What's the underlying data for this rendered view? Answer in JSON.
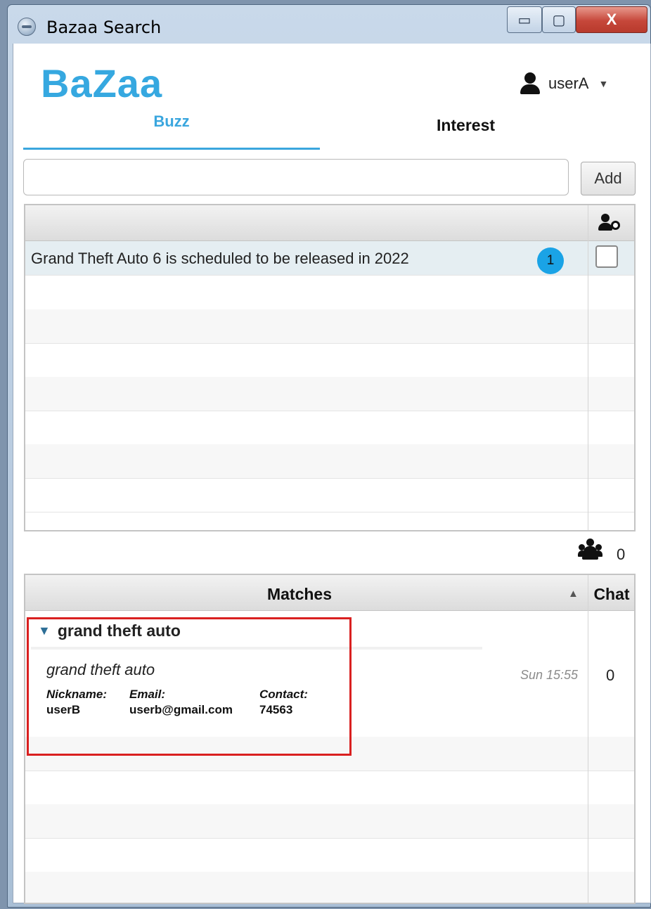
{
  "window": {
    "title": "Bazaa Search",
    "min_glyph": "▭",
    "max_glyph": "▢",
    "close_glyph": "X"
  },
  "app": {
    "logo": "BaZaa"
  },
  "user": {
    "name": "userA",
    "caret": "▼"
  },
  "tabs": {
    "buzz": "Buzz",
    "interest": "Interest",
    "active": "Buzz"
  },
  "buzz_form": {
    "input_value": "",
    "add_label": "Add"
  },
  "buzz_table": {
    "rows": [
      {
        "text": "Grand Theft Auto 6 is scheduled to be released in 2022",
        "count": "1",
        "shared": false
      }
    ]
  },
  "group_count": "0",
  "matches_table": {
    "header": "Matches",
    "sort_glyph": "▲",
    "chat_header": "Chat",
    "groups": [
      {
        "expand_glyph": "▼",
        "name": "grand theft auto",
        "match": {
          "title": "grand theft auto",
          "nickname_label": "Nickname:",
          "nickname": "userB",
          "email_label": "Email:",
          "email": "userb@gmail.com",
          "contact_label": "Contact:",
          "contact": "74563",
          "time": "Sun 15:55",
          "chat_count": "0"
        }
      }
    ]
  },
  "colors": {
    "accent": "#36a8e0",
    "badge": "#1aa3e6",
    "highlight": "#d92020"
  }
}
